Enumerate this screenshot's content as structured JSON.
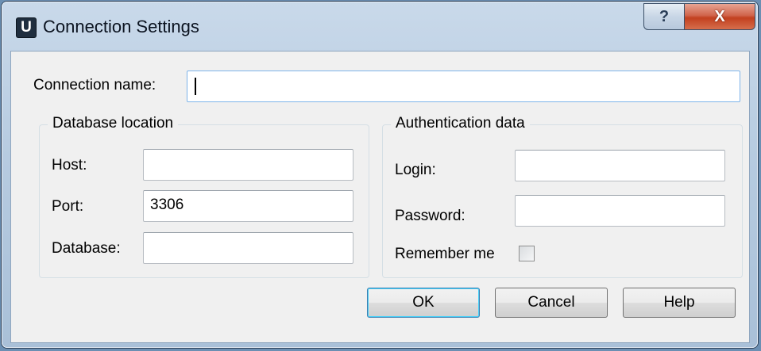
{
  "window": {
    "app_icon_letter": "U",
    "title": "Connection Settings",
    "help_glyph": "?",
    "close_glyph": "X"
  },
  "connection": {
    "name_label": "Connection name:",
    "name_value": ""
  },
  "database_location": {
    "title": "Database location",
    "host_label": "Host:",
    "host_value": "",
    "port_label": "Port:",
    "port_value": "3306",
    "database_label": "Database:",
    "database_value": ""
  },
  "authentication": {
    "title": "Authentication data",
    "login_label": "Login:",
    "login_value": "",
    "password_label": "Password:",
    "password_value": "",
    "remember_label": "Remember me",
    "remember_checked": false
  },
  "buttons": {
    "ok": "OK",
    "cancel": "Cancel",
    "help": "Help"
  }
}
